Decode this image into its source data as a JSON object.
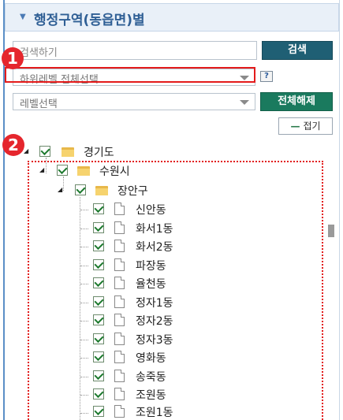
{
  "header": {
    "title": "행정구역(동읍면)별",
    "collapse_arrow": "▼"
  },
  "search": {
    "placeholder": "검색하기",
    "button_label": "검색"
  },
  "sublevel_select": {
    "value": "하위레벨 전체선택"
  },
  "help_button": {
    "label": "?"
  },
  "level_select": {
    "value": "레벨선택"
  },
  "clear_button": {
    "label": "전체해제"
  },
  "fold_button": {
    "symbol": "—",
    "label": "접기"
  },
  "markers": {
    "first": "1",
    "second": "2"
  },
  "tree": {
    "root": {
      "label": "경기도",
      "checked": true
    },
    "city": {
      "label": "수원시",
      "checked": true
    },
    "district": {
      "label": "장안구",
      "checked": true
    },
    "dongs": [
      {
        "label": "신안동",
        "checked": true
      },
      {
        "label": "화서1동",
        "checked": true
      },
      {
        "label": "화서2동",
        "checked": true
      },
      {
        "label": "파장동",
        "checked": true
      },
      {
        "label": "율천동",
        "checked": true
      },
      {
        "label": "정자1동",
        "checked": true
      },
      {
        "label": "정자2동",
        "checked": true
      },
      {
        "label": "정자3동",
        "checked": true
      },
      {
        "label": "영화동",
        "checked": true
      },
      {
        "label": "송죽동",
        "checked": true
      },
      {
        "label": "조원동",
        "checked": true
      },
      {
        "label": "조원1동",
        "checked": true
      }
    ]
  },
  "colors": {
    "accent": "#1f5f74",
    "clear_button": "#1a7a5e",
    "marker": "#e5262d",
    "highlight": "#e41b1b",
    "header_text": "#2f5f95"
  }
}
